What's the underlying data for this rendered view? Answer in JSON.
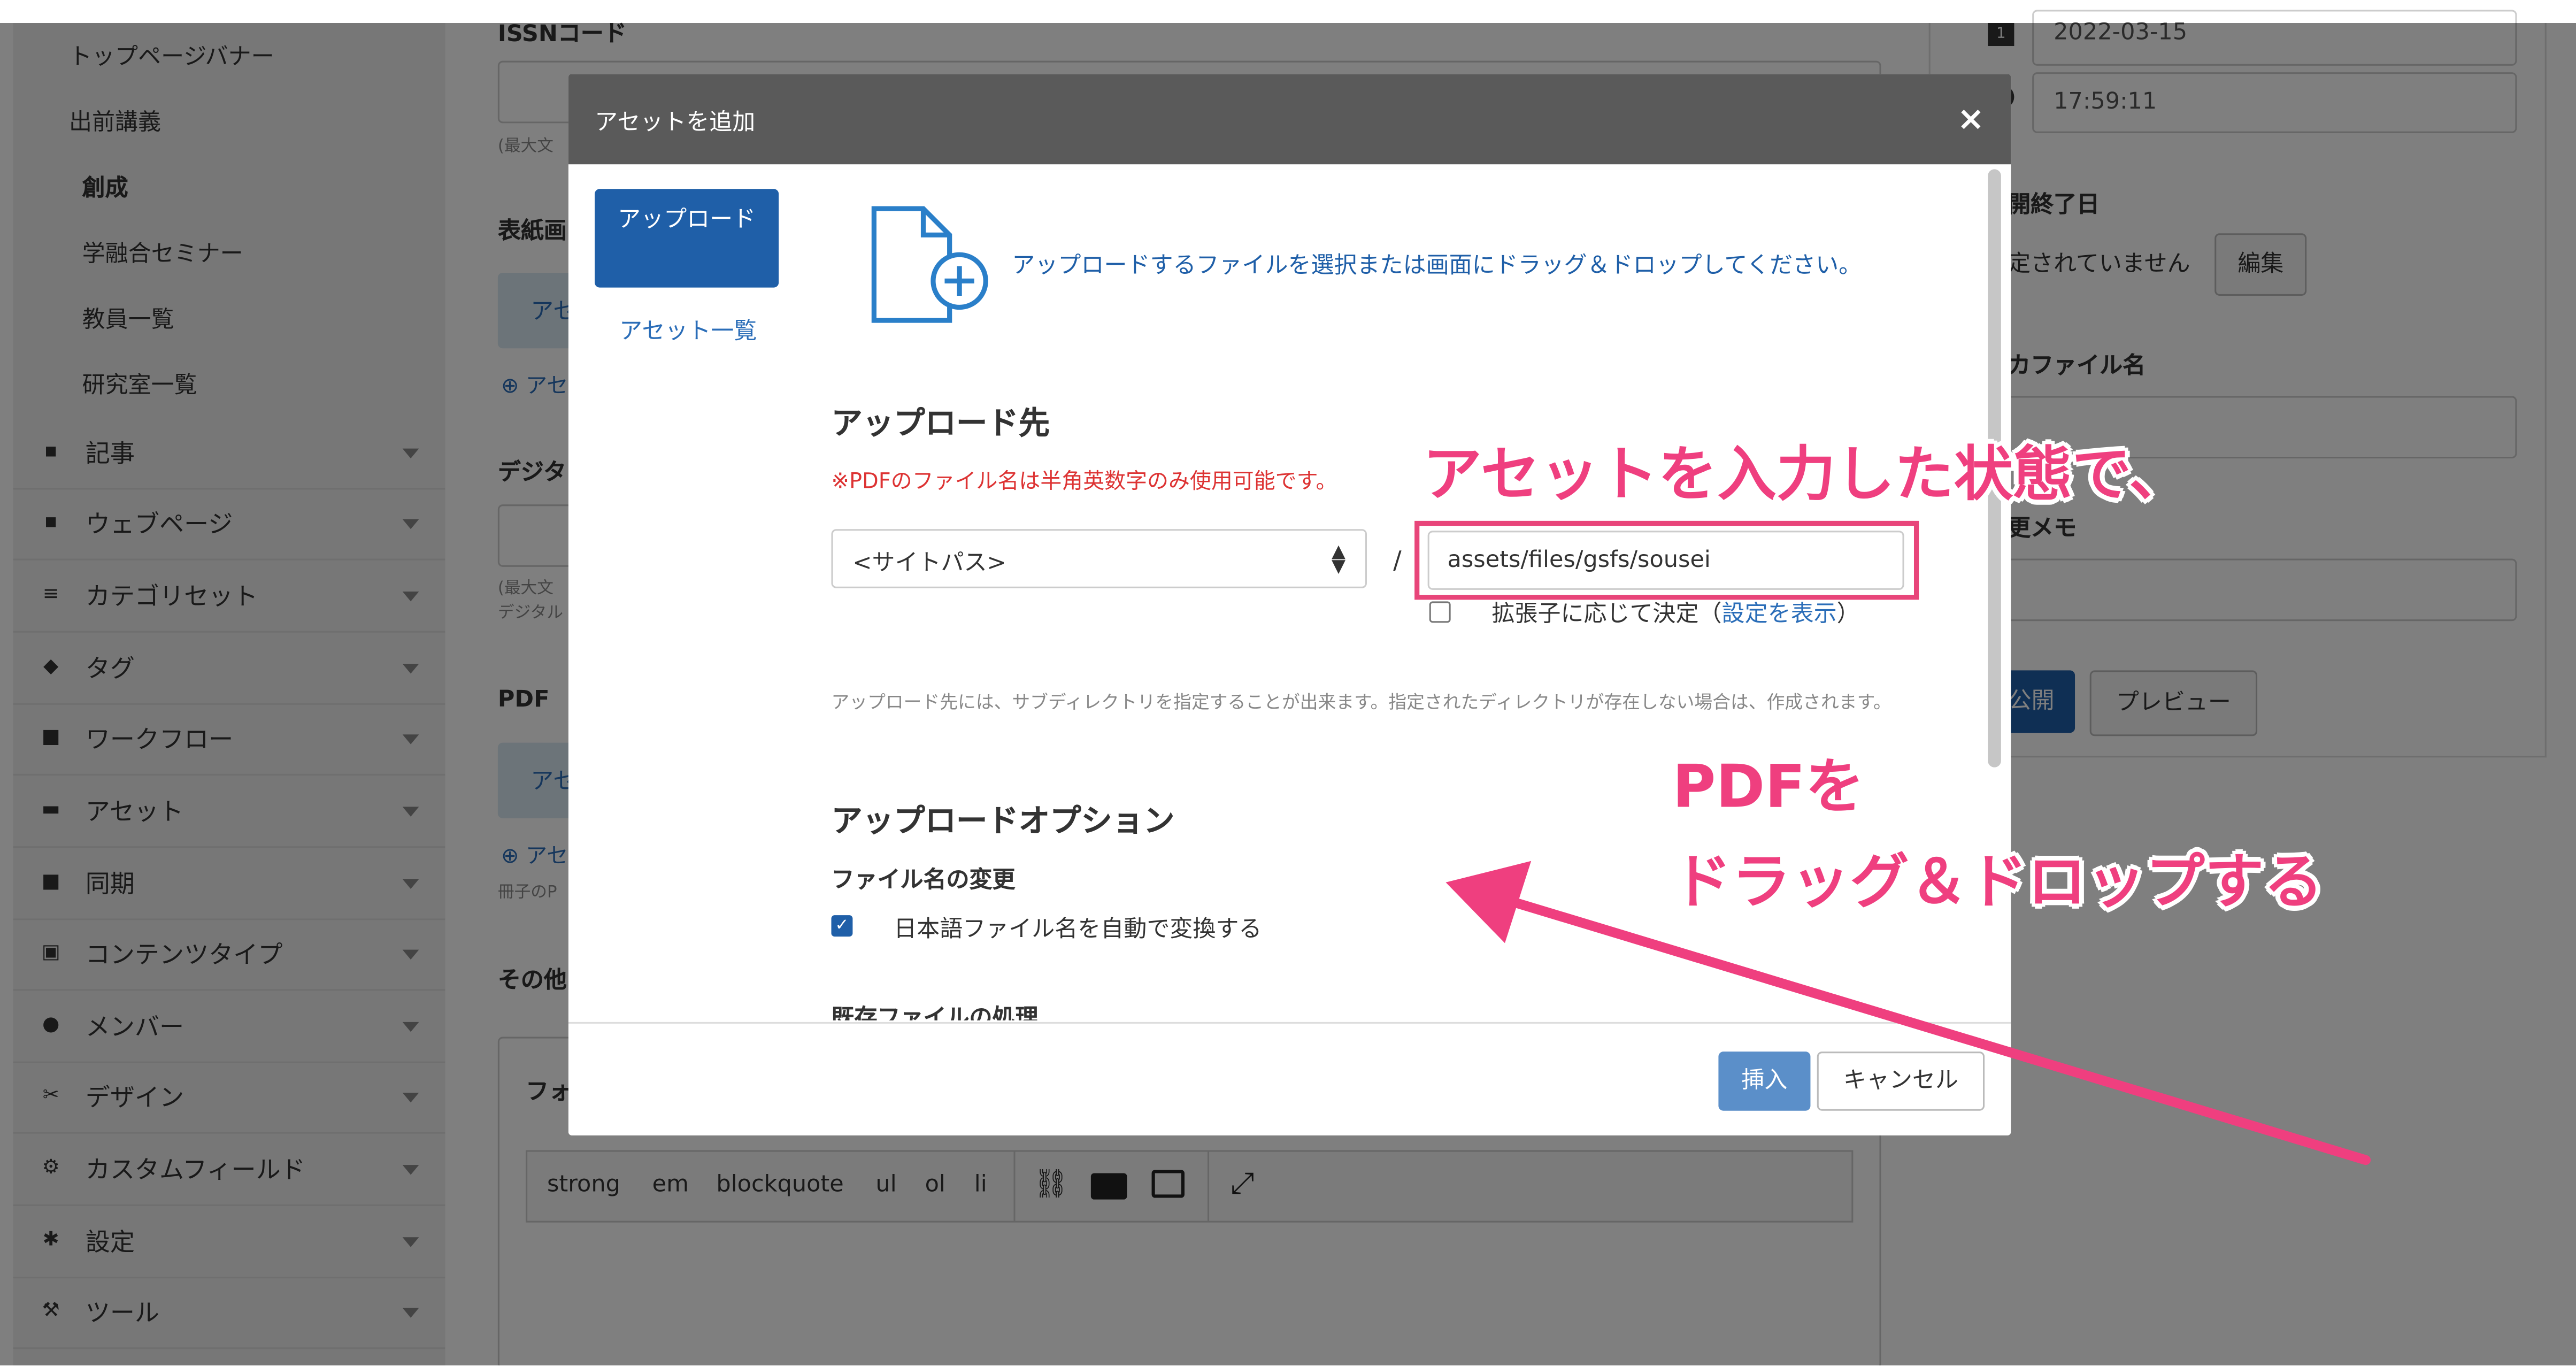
{
  "sidebar": {
    "sub_items": [
      "トップページバナー",
      "出前講義",
      "創成",
      "学融合セミナー",
      "教員一覧",
      "研究室一覧"
    ],
    "active_sub": "創成",
    "items": [
      {
        "label": "記事",
        "icon": "article-icon"
      },
      {
        "label": "ウェブページ",
        "icon": "webpage-icon"
      },
      {
        "label": "カテゴリセット",
        "icon": "category-icon"
      },
      {
        "label": "タグ",
        "icon": "tag-icon"
      },
      {
        "label": "ワークフロー",
        "icon": "workflow-icon"
      },
      {
        "label": "アセット",
        "icon": "asset-icon"
      },
      {
        "label": "同期",
        "icon": "sync-icon"
      },
      {
        "label": "コンテンツタイプ",
        "icon": "content-type-icon"
      },
      {
        "label": "メンバー",
        "icon": "member-icon"
      },
      {
        "label": "デザイン",
        "icon": "design-icon"
      },
      {
        "label": "カスタムフィールド",
        "icon": "custom-field-icon"
      },
      {
        "label": "設定",
        "icon": "gear-icon"
      },
      {
        "label": "ツール",
        "icon": "wrench-icon"
      }
    ]
  },
  "main": {
    "issn_label": "ISSNコード",
    "issn_note": "(最大文",
    "cover_label": "表紙画",
    "cover_box": "アセ",
    "cover_add": "⊕ アセ",
    "digital_label": "デジタ",
    "digital_note1": "(最大文",
    "digital_note2": "デジタル",
    "pdf_label": "PDF",
    "pdf_box": "アセ",
    "pdf_add": "⊕ アセ",
    "pdf_note": "冊子のP",
    "other_label": "その他",
    "editor_label": "フォ",
    "toolbar": [
      "strong",
      "em",
      "blockquote",
      "ul",
      "ol",
      "li"
    ]
  },
  "right_panel": {
    "date": "2022-03-15",
    "time": "17:59:11",
    "end_label": "開終了日",
    "end_value": "定されていません",
    "edit_button": "編集",
    "file_label": "カファイル名",
    "memo_label": "更メモ",
    "publish_button": "公開",
    "preview_button": "プレビュー"
  },
  "modal": {
    "title": "アセットを追加",
    "close": "×",
    "tab_upload": "アップロード",
    "tab_list": "アセット一覧",
    "drop_message": "アップロードするファイルを選択または画面にドラッグ＆ドロップしてください。",
    "upload_dest_heading": "アップロード先",
    "warning": "※PDFのファイル名は半角英数字のみ使用可能です。",
    "site_path": "<サイトパス>",
    "slash": "/",
    "path_value": "assets/files/gsfs/sousei",
    "extension_check_label": "拡張子に応じて決定（",
    "extension_link": "設定を表示",
    "extension_close": "）",
    "dest_note": "アップロード先には、サブディレクトリを指定することが出来ます。指定されたディレクトリが存在しない場合は、作成されます。",
    "options_heading": "アップロードオプション",
    "rename_label": "ファイル名の変更",
    "auto_convert_label": "日本語ファイル名を自動で変換する",
    "existing_label": "既存ファイルの処理",
    "insert_button": "挿入",
    "cancel_button": "キャンセル"
  },
  "annotations": {
    "line1": "アセットを入力した状態で、",
    "line2": "PDFを",
    "line3": "ドラッグ＆ドロップする",
    "color": "#ef3f7f"
  }
}
